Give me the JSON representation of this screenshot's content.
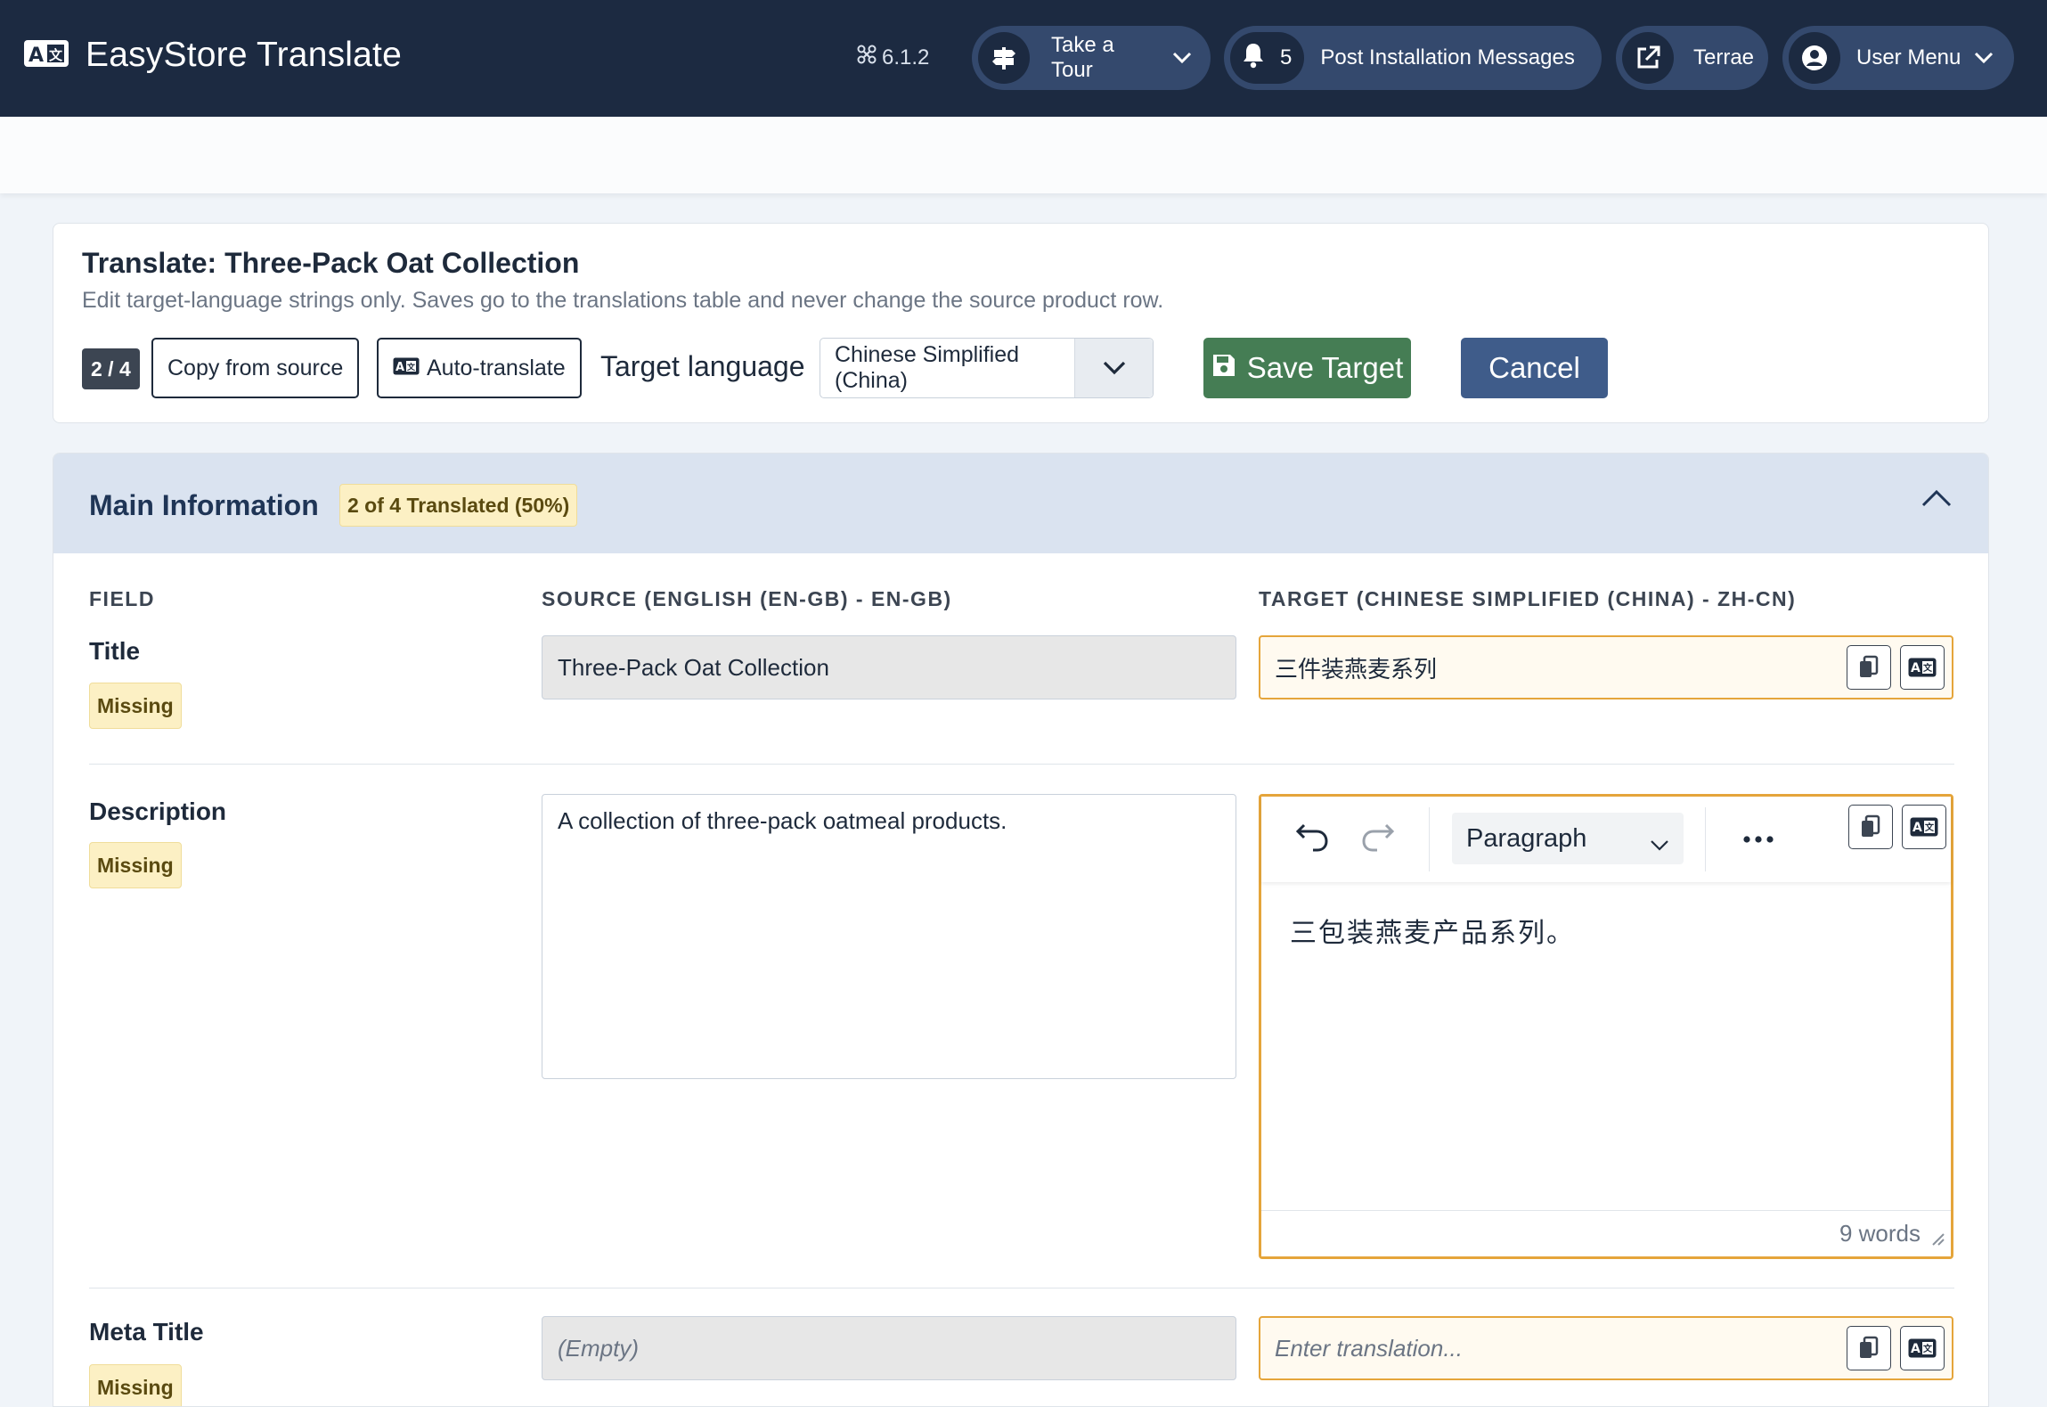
{
  "header": {
    "app_title": "EasyStore Translate",
    "version": "6.1.2",
    "tour_label": "Take a Tour",
    "notification_count": "5",
    "messages_label": "Post Installation Messages",
    "site_label": "Terrae",
    "user_menu_label": "User Menu"
  },
  "translate": {
    "title": "Translate: Three-Pack Oat Collection",
    "subtitle": "Edit target-language strings only. Saves go to the translations table and never change the source product row.",
    "counter": "2 / 4",
    "copy_from_source": "Copy from source",
    "auto_translate": "Auto-translate",
    "target_language_label": "Target language",
    "target_language_value": "Chinese Simplified (China)",
    "save_label": "Save Target",
    "cancel_label": "Cancel"
  },
  "section": {
    "title": "Main Information",
    "progress": "2 of 4 Translated (50%)",
    "columns": {
      "field": "FIELD",
      "source": "SOURCE (ENGLISH (EN-GB) - EN-GB)",
      "target": "TARGET (CHINESE SIMPLIFIED (CHINA) - ZH-CN)"
    },
    "fields": [
      {
        "name": "Title",
        "status": "Missing",
        "source": "Three-Pack Oat Collection",
        "target": "三件装燕麦系列"
      },
      {
        "name": "Description",
        "status": "Missing",
        "source": "A collection of three-pack oatmeal products.",
        "target": "三包装燕麦产品系列。",
        "format": "Paragraph",
        "word_count": "9 words"
      },
      {
        "name": "Meta Title",
        "status": "Missing",
        "source": "(Empty)",
        "target_placeholder": "Enter translation..."
      }
    ]
  },
  "colors": {
    "header_bg": "#1c2a41",
    "pill_bg": "#34496d",
    "save_green": "#457d54",
    "cancel_blue": "#3f5c8a",
    "target_border": "#e5a53b",
    "panel_head_bg": "#dae3f0"
  },
  "icons": [
    "translate-icon",
    "joomla-icon",
    "signpost-icon",
    "bell-icon",
    "external-link-icon",
    "user-circle-icon",
    "chevron-down-icon",
    "floppy-disk-icon",
    "chevron-up-icon",
    "copy-icon",
    "undo-icon",
    "redo-icon",
    "more-icon",
    "resize-grip-icon"
  ]
}
